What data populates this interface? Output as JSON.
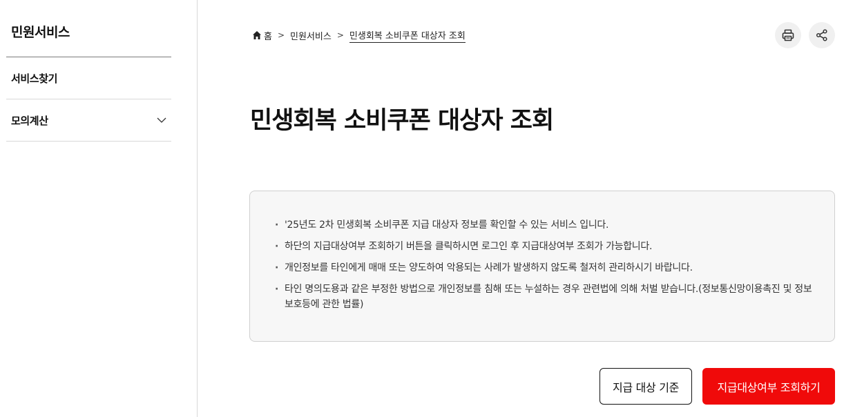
{
  "sidebar": {
    "title": "민원서비스",
    "items": [
      {
        "label": "서비스찾기"
      },
      {
        "label": "모의계산"
      }
    ]
  },
  "breadcrumb": {
    "home": "홈",
    "level1": "민원서비스",
    "current": "민생회복 소비쿠폰 대상자 조회"
  },
  "toolbar": {
    "print_icon": "print-icon",
    "share_icon": "share-icon"
  },
  "page": {
    "title": "민생회복 소비쿠폰 대상자 조회"
  },
  "notice": {
    "items": [
      "'25년도 2차 민생회복 소비쿠폰 지급 대상자 정보를 확인할 수 있는 서비스 입니다.",
      "하단의 지급대상여부 조회하기 버튼을 클릭하시면 로그인 후 지급대상여부 조회가 가능합니다.",
      "개인정보를 타인에게 매매 또는 양도하여 악용되는 사례가 발생하지 않도록 철저히 관리하시기 바랍니다.",
      "타인 명의도용과 같은 부정한 방법으로 개인정보를 침해 또는 누설하는 경우 관련법에 의해 처벌 받습니다.(정보통신망이용촉진 및 정보보호등에 관한 법률)"
    ]
  },
  "actions": {
    "criteria_label": "지급 대상 기준",
    "check_label": "지급대상여부 조회하기"
  },
  "colors": {
    "primary": "#f00a0a",
    "box_bg": "#f7f7f7"
  }
}
